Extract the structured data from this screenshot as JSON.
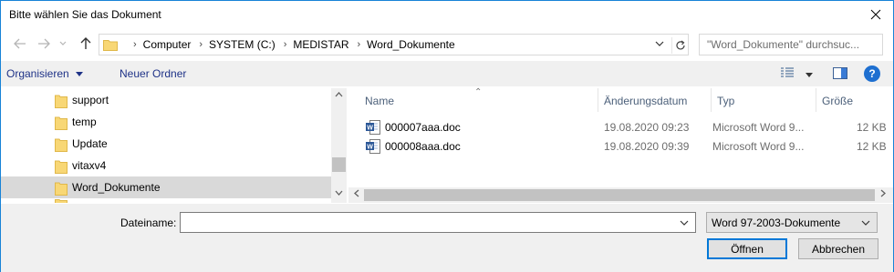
{
  "title": "Bitte wählen Sie das Dokument",
  "nav": {
    "breadcrumbs": [
      "Computer",
      "SYSTEM (C:)",
      "MEDISTAR",
      "Word_Dokumente"
    ],
    "search_placeholder": "\"Word_Dokumente\" durchsuc..."
  },
  "toolbar": {
    "organize_label": "Organisieren",
    "new_folder_label": "Neuer Ordner"
  },
  "tree": {
    "items": [
      {
        "label": "support"
      },
      {
        "label": "temp"
      },
      {
        "label": "Update"
      },
      {
        "label": "vitaxv4"
      },
      {
        "label": "Word_Dokumente"
      }
    ],
    "selected_index": 4
  },
  "list": {
    "columns": {
      "name": "Name",
      "date": "Änderungsdatum",
      "type": "Typ",
      "size": "Größe"
    },
    "rows": [
      {
        "name": "000007aaa.doc",
        "date": "19.08.2020 09:23",
        "type": "Microsoft Word 9...",
        "size": "12 KB"
      },
      {
        "name": "000008aaa.doc",
        "date": "19.08.2020 09:39",
        "type": "Microsoft Word 9...",
        "size": "12 KB"
      }
    ]
  },
  "bottom": {
    "filename_label": "Dateiname:",
    "filename_value": "",
    "filetype_value": "Word 97-2003-Dokumente",
    "open_label": "Öffnen",
    "cancel_label": "Abbrechen"
  },
  "colors": {
    "window_border": "#1883d7",
    "link_blue": "#1e3287",
    "selected_bg": "#d9d9d9",
    "default_button_border": "#0078d7"
  }
}
